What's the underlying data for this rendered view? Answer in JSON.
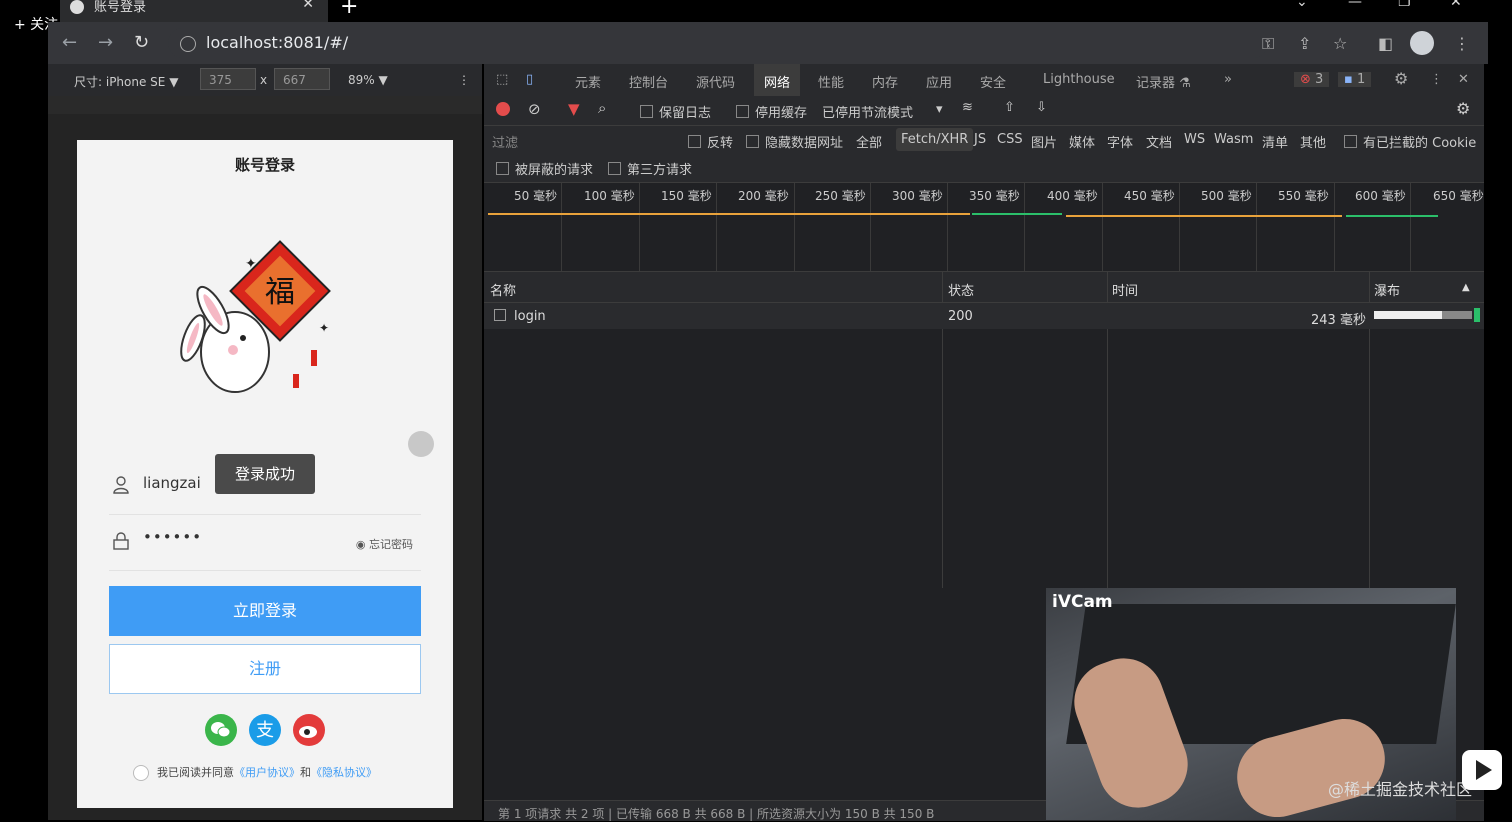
{
  "browser": {
    "follow_label": "+ 关注",
    "tab_title": "账号登录",
    "url": "localhost:8081/#/"
  },
  "device_toolbar": {
    "device_label": "尺寸: iPhone SE ▼",
    "width": "375",
    "times": "x",
    "height": "667",
    "zoom": "89% ▼"
  },
  "page": {
    "title": "账号登录",
    "toast": "登录成功",
    "username": "liangzai",
    "password": "••••••",
    "forgot": "忘记密码",
    "login_button": "立即登录",
    "register_button": "注册",
    "agree_prefix": "我已阅读并同意",
    "user_agreement": "《用户协议》",
    "and": "和",
    "privacy_agreement": "《隐私协议》",
    "mascot_char": "福"
  },
  "devtools": {
    "tabs": [
      "元素",
      "控制台",
      "源代码",
      "网络",
      "性能",
      "内存",
      "应用",
      "安全",
      "Lighthouse",
      "记录器 ⚗",
      "»"
    ],
    "active_tab": "网络",
    "errors": "3",
    "messages": "1",
    "network_bar": {
      "preserve_log": "保留日志",
      "disable_cache": "停用缓存",
      "throttle": "已停用节流模式"
    },
    "filter": {
      "placeholder": "过滤",
      "invert": "反转",
      "hide_data_urls": "隐藏数据网址",
      "types": [
        "全部",
        "Fetch/XHR",
        "JS",
        "CSS",
        "图片",
        "媒体",
        "字体",
        "文档",
        "WS",
        "Wasm",
        "清单",
        "其他"
      ],
      "blocked_cookies": "有已拦截的 Cookie",
      "blocked_requests": "被屏蔽的请求",
      "third_party": "第三方请求"
    },
    "timeline_ticks": [
      "50 毫秒",
      "100 毫秒",
      "150 毫秒",
      "200 毫秒",
      "250 毫秒",
      "300 毫秒",
      "350 毫秒",
      "400 毫秒",
      "450 毫秒",
      "500 毫秒",
      "550 毫秒",
      "600 毫秒",
      "650 毫秒"
    ],
    "columns": {
      "name": "名称",
      "status": "状态",
      "time": "时间",
      "waterfall": "瀑布"
    },
    "rows": [
      {
        "name": "login",
        "status": "200",
        "time": "243 毫秒"
      }
    ],
    "status_bar": "第 1 项请求  共 2 项  |  已传输 668 B  共 668 B  |  所选资源大小为 150 B  共 150 B"
  },
  "overlay": {
    "camera_label": "iVCam",
    "watermark": "@稀土掘金技术社区"
  },
  "colors": {
    "primary": "#3f9cf5",
    "record_red": "#e34c4c",
    "devtools_bg": "#202124"
  }
}
